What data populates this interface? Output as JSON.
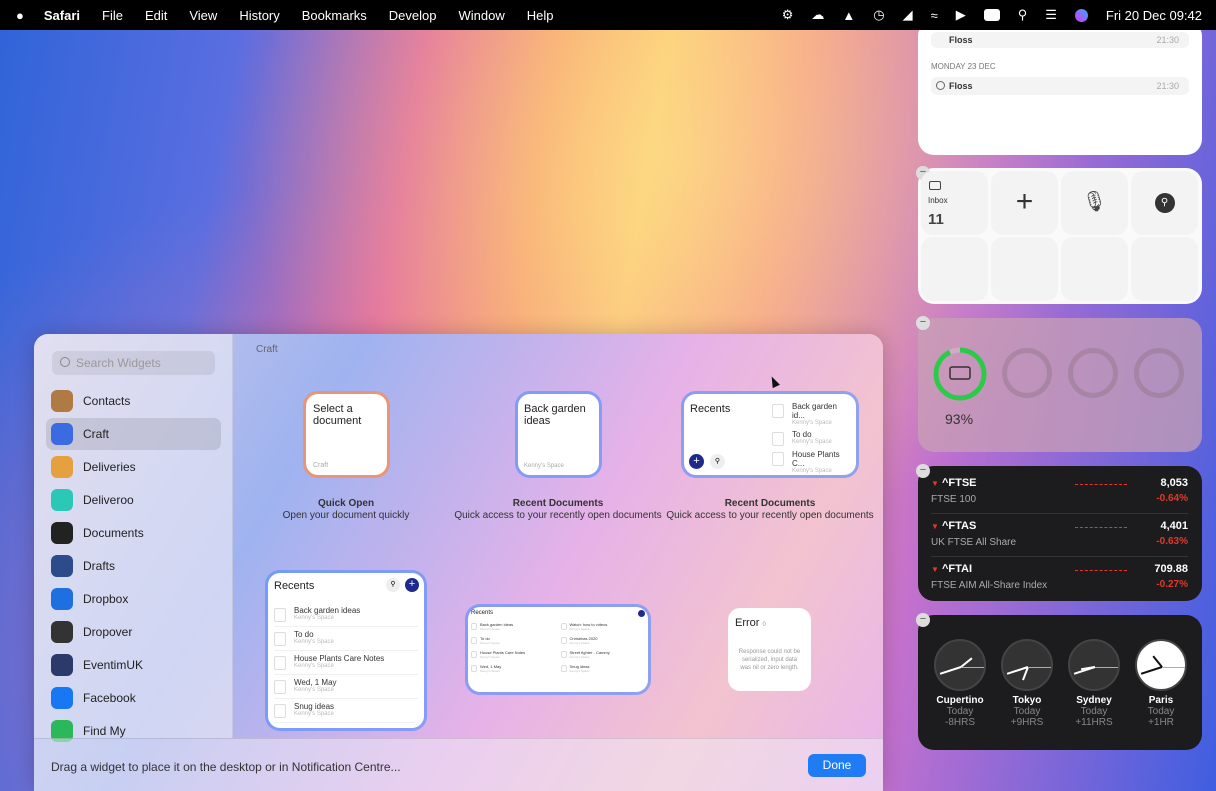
{
  "menubar": {
    "items": [
      "Safari",
      "File",
      "Edit",
      "View",
      "History",
      "Bookmarks",
      "Develop",
      "Window",
      "Help"
    ],
    "clock": "Fri 20 Dec  09:42"
  },
  "gallery": {
    "search_placeholder": "Search Widgets",
    "breadcrumb": "Craft",
    "apps": [
      "Contacts",
      "Craft",
      "Deliveries",
      "Deliveroo",
      "Documents",
      "Drafts",
      "Dropbox",
      "Dropover",
      "EventimUK",
      "Facebook",
      "Find My"
    ],
    "footer": "Drag a widget to place it on the desktop or in Notification Centre...",
    "done": "Done",
    "quick_open": {
      "title": "Select a document",
      "brand": "Craft",
      "name": "Quick Open",
      "desc": "Open your document quickly"
    },
    "recent_small": {
      "title": "Back garden ideas",
      "space": "Kenny's Space",
      "name": "Recent Documents",
      "desc": "Quick access to your recently open documents"
    },
    "recent_medium": {
      "title": "Recents",
      "items": [
        {
          "t": "Back garden id...",
          "s": "Kenny's Space"
        },
        {
          "t": "To do",
          "s": "Kenny's Space"
        },
        {
          "t": "House Plants C...",
          "s": "Kenny's Space"
        }
      ],
      "name": "Recent Documents",
      "desc": "Quick access to your recently open documents"
    },
    "recent_large": {
      "title": "Recents",
      "items": [
        {
          "t": "Back garden ideas",
          "s": "Kenny's Space"
        },
        {
          "t": "To do",
          "s": "Kenny's Space"
        },
        {
          "t": "House Plants Care Notes",
          "s": "Kenny's Space"
        },
        {
          "t": "Wed, 1 May",
          "s": "Kenny's Space"
        },
        {
          "t": "Snug ideas",
          "s": "Kenny's Space"
        }
      ]
    },
    "recent_wide": {
      "title": "Recents",
      "items": [
        {
          "t": "Back garden ideas",
          "s": "Kenny's Space"
        },
        {
          "t": "Watch: how to videos",
          "s": "Kenny's Space"
        },
        {
          "t": "To do",
          "s": "Kenny's Space"
        },
        {
          "t": "Christmas 2020",
          "s": "Kenny's Space"
        },
        {
          "t": "House Plants Care Notes",
          "s": "Kenny's Space"
        },
        {
          "t": "Street fighter - Cammy",
          "s": "Kenny's Space"
        },
        {
          "t": "Wed, 1 May",
          "s": "Kenny's Space"
        },
        {
          "t": "Snug ideas",
          "s": "Kenny's Space"
        }
      ]
    },
    "error": {
      "title": "Error",
      "code": "0",
      "msg": "Response could not be serialized, input data was nil or zero length."
    }
  },
  "reminders": {
    "top": {
      "t": "Floss",
      "time": "21:30"
    },
    "day": "MONDAY 23 DEC",
    "item": {
      "t": "Floss",
      "time": "21:30"
    }
  },
  "craft_quick": {
    "inbox": "Inbox",
    "count": "11"
  },
  "battery": {
    "percent_label": "93%",
    "percent": 93
  },
  "stocks": [
    {
      "sym": "^FTSE",
      "name": "FTSE 100",
      "price": "8,053",
      "chg": "-0.64%"
    },
    {
      "sym": "^FTAS",
      "name": "UK FTSE All Share",
      "price": "4,401",
      "chg": "-0.63%"
    },
    {
      "sym": "^FTAI",
      "name": "FTSE AIM All-Share Index",
      "price": "709.88",
      "chg": "-0.27%"
    }
  ],
  "clocks": [
    {
      "city": "Cupertino",
      "day": "Today",
      "off": "-8HRS",
      "h": 1.7,
      "m": 42
    },
    {
      "city": "Tokyo",
      "day": "Today",
      "off": "+9HRS",
      "h": 6.7,
      "m": 42
    },
    {
      "city": "Sydney",
      "day": "Today",
      "off": "+11HRS",
      "h": 8.7,
      "m": 42
    },
    {
      "city": "Paris",
      "day": "Today",
      "off": "+1HR",
      "h": 10.7,
      "m": 42
    }
  ],
  "colors": {
    "accent": "#1f7cf5",
    "craft_blue": "#1e2a8c",
    "down": "#e0392b",
    "battery": "#2ec84a"
  }
}
